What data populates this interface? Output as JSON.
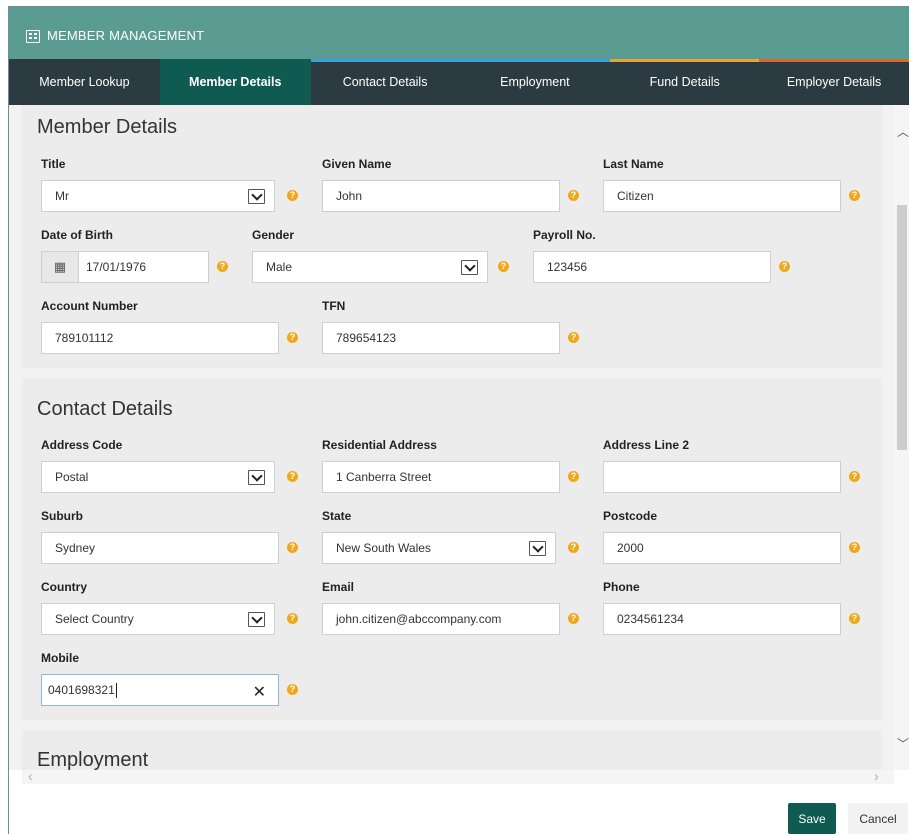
{
  "header": {
    "title": "MEMBER MANAGEMENT",
    "icon": "grid-icon"
  },
  "tabs": [
    {
      "label": "Member Lookup",
      "stripe": ""
    },
    {
      "label": "Member Details",
      "stripe": "#0f5a51"
    },
    {
      "label": "Contact Details",
      "stripe": "#3aa0d4"
    },
    {
      "label": "Employment",
      "stripe": "#3aa0d4"
    },
    {
      "label": "Fund Details",
      "stripe": "#e8a33a"
    },
    {
      "label": "Employer Details",
      "stripe": "#d46b2e"
    }
  ],
  "member": {
    "title": "Member Details",
    "title_label": "Title",
    "title_value": "Mr",
    "given_label": "Given Name",
    "given_value": "John",
    "last_label": "Last Name",
    "last_value": "Citizen",
    "dob_label": "Date of Birth",
    "dob_value": "17/01/1976",
    "gender_label": "Gender",
    "gender_value": "Male",
    "payroll_label": "Payroll No.",
    "payroll_value": "123456",
    "account_label": "Account Number",
    "account_value": "789101112",
    "tfn_label": "TFN",
    "tfn_value": "789654123"
  },
  "contact": {
    "title": "Contact Details",
    "address_code_label": "Address Code",
    "address_code_value": "Postal",
    "residential_label": "Residential Address",
    "residential_value": "1 Canberra Street",
    "line2_label": "Address Line 2",
    "line2_value": "",
    "suburb_label": "Suburb",
    "suburb_value": "Sydney",
    "state_label": "State",
    "state_value": "New South Wales",
    "postcode_label": "Postcode",
    "postcode_value": "2000",
    "country_label": "Country",
    "country_value": "Select Country",
    "email_label": "Email",
    "email_value": "john.citizen@abccompany.com",
    "phone_label": "Phone",
    "phone_value": "0234561234",
    "mobile_label": "Mobile",
    "mobile_value": "0401698321"
  },
  "employment": {
    "title": "Employment"
  },
  "footer": {
    "save_label": "Save",
    "cancel_label": "Cancel"
  },
  "colors": {
    "header": "#5a9c91",
    "tabbar": "#2b3b41",
    "accent": "#0f5a51",
    "help": "#f0a818"
  }
}
